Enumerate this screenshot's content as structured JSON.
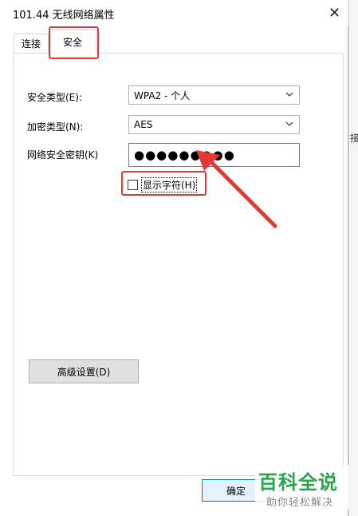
{
  "window": {
    "title": "101.44 无线网络属性",
    "close_glyph": "✕"
  },
  "tabs": [
    {
      "label": "连接",
      "selected": false
    },
    {
      "label": "安全",
      "selected": true
    }
  ],
  "fields": {
    "security_type_label": "安全类型(E):",
    "security_type_value": "WPA2 - 个人",
    "encryption_type_label": "加密类型(N):",
    "encryption_type_value": "AES",
    "key_label": "网络安全密钥(K)",
    "key_value": "●●●●●●●●●"
  },
  "show_chars": {
    "label": "显示字符(H)",
    "checked": false
  },
  "buttons": {
    "advanced": "高级设置(D)",
    "ok": "确定"
  },
  "background": {
    "right_edge_text": "接"
  },
  "watermark": {
    "big": "百科全说",
    "small": "助你轻松解决"
  },
  "colors": {
    "highlight": "#e53935",
    "watermark_green": "#2aa44a",
    "ok_border": "#0078d7"
  },
  "icons": {
    "dropdown": "chevron-down-icon",
    "close": "close-icon",
    "annotation": "arrow-icon"
  }
}
